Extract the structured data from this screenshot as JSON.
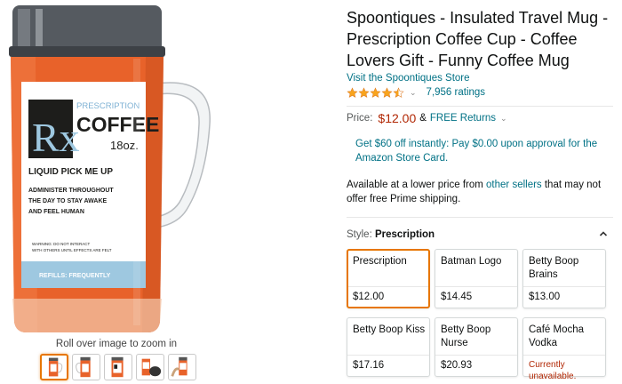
{
  "product": {
    "title": "Spoontiques - Insulated Travel Mug - Prescription Coffee Cup - Coffee Lovers Gift - Funny Coffee Mug",
    "store_link": "Visit the Spoontiques Store",
    "rating_stars": 4.5,
    "ratings_count": "7,956 ratings"
  },
  "price": {
    "label": "Price:",
    "amount": "$12.00",
    "amp": "&",
    "returns": "FREE Returns"
  },
  "promo": "Get $60 off instantly: Pay $0.00 upon approval for the Amazon Store Card.",
  "availability": {
    "prefix": "Available at a lower price from ",
    "link": "other sellers",
    "suffix": " that may not offer free Prime shipping."
  },
  "style": {
    "label": "Style: ",
    "value": "Prescription"
  },
  "variants": [
    {
      "name": "Prescription",
      "price": "$12.00"
    },
    {
      "name": "Batman Logo",
      "price": "$14.45"
    },
    {
      "name": "Betty Boop Brains",
      "price": "$13.00"
    },
    {
      "name": "Betty Boop Kiss",
      "price": "$17.16"
    },
    {
      "name": "Betty Boop Nurse",
      "price": "$20.93"
    },
    {
      "name": "Café Mocha Vodka",
      "status": "Currently unavailable."
    }
  ],
  "image": {
    "zoom_hint": "Roll over image to zoom in",
    "label": {
      "small_caption": "PRESCRIPTION",
      "rx": "Rx",
      "main": "COFFEE",
      "size": "18oz.",
      "line1": "LIQUID PICK ME UP",
      "line2": "ADMINISTER THROUGHOUT",
      "line3": "THE DAY TO STAY AWAKE",
      "line4": "AND FEEL HUMAN",
      "warning1": "WARNING: DO NOT INTERACT",
      "warning2": "WITH OTHERS UNTIL EFFECTS ARE FELT",
      "refills": "REFILLS: FREQUENTLY"
    }
  },
  "colors": {
    "link": "#007185",
    "price": "#b12704",
    "selected_border": "#e77600",
    "mug_orange": "#e8622a",
    "label_blue": "#9ec8e0"
  },
  "icons": {
    "star": "star-icon",
    "caret": "chevron-down-icon",
    "collapse": "chevron-up-icon"
  }
}
